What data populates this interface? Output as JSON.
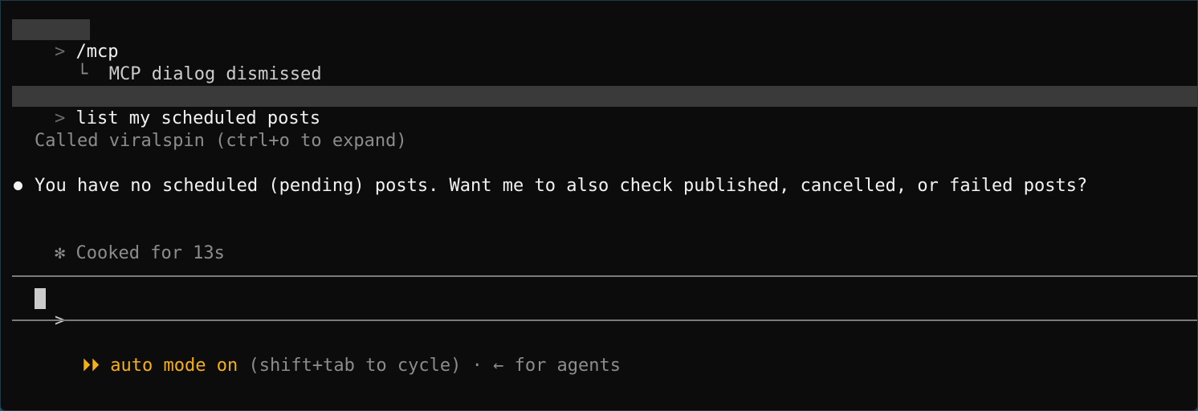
{
  "history": {
    "mcp_command": {
      "prompt_symbol": ">",
      "text": "/mcp",
      "branch_symbol": "└",
      "result": "MCP dialog dismissed"
    },
    "user_query": {
      "prompt_symbol": ">",
      "text": "list my scheduled posts"
    },
    "tool_call": {
      "text": "Called viralspin (ctrl+o to expand)"
    },
    "assistant_reply": {
      "text": "You have no scheduled (pending) posts. Want me to also check published, cancelled, or failed posts?"
    },
    "status": {
      "symbol": "✻",
      "text": "Cooked for 13s"
    }
  },
  "input": {
    "prompt_symbol": ">",
    "value": ""
  },
  "footer": {
    "mode_icon": "⏵⏵",
    "mode_label": "auto mode on",
    "hint": "(shift+tab to cycle) · ← for agents"
  },
  "colors": {
    "background": "#0c0c0c",
    "text": "#cccccc",
    "accent": "#f5b014",
    "highlight": "#3a3a3a"
  }
}
